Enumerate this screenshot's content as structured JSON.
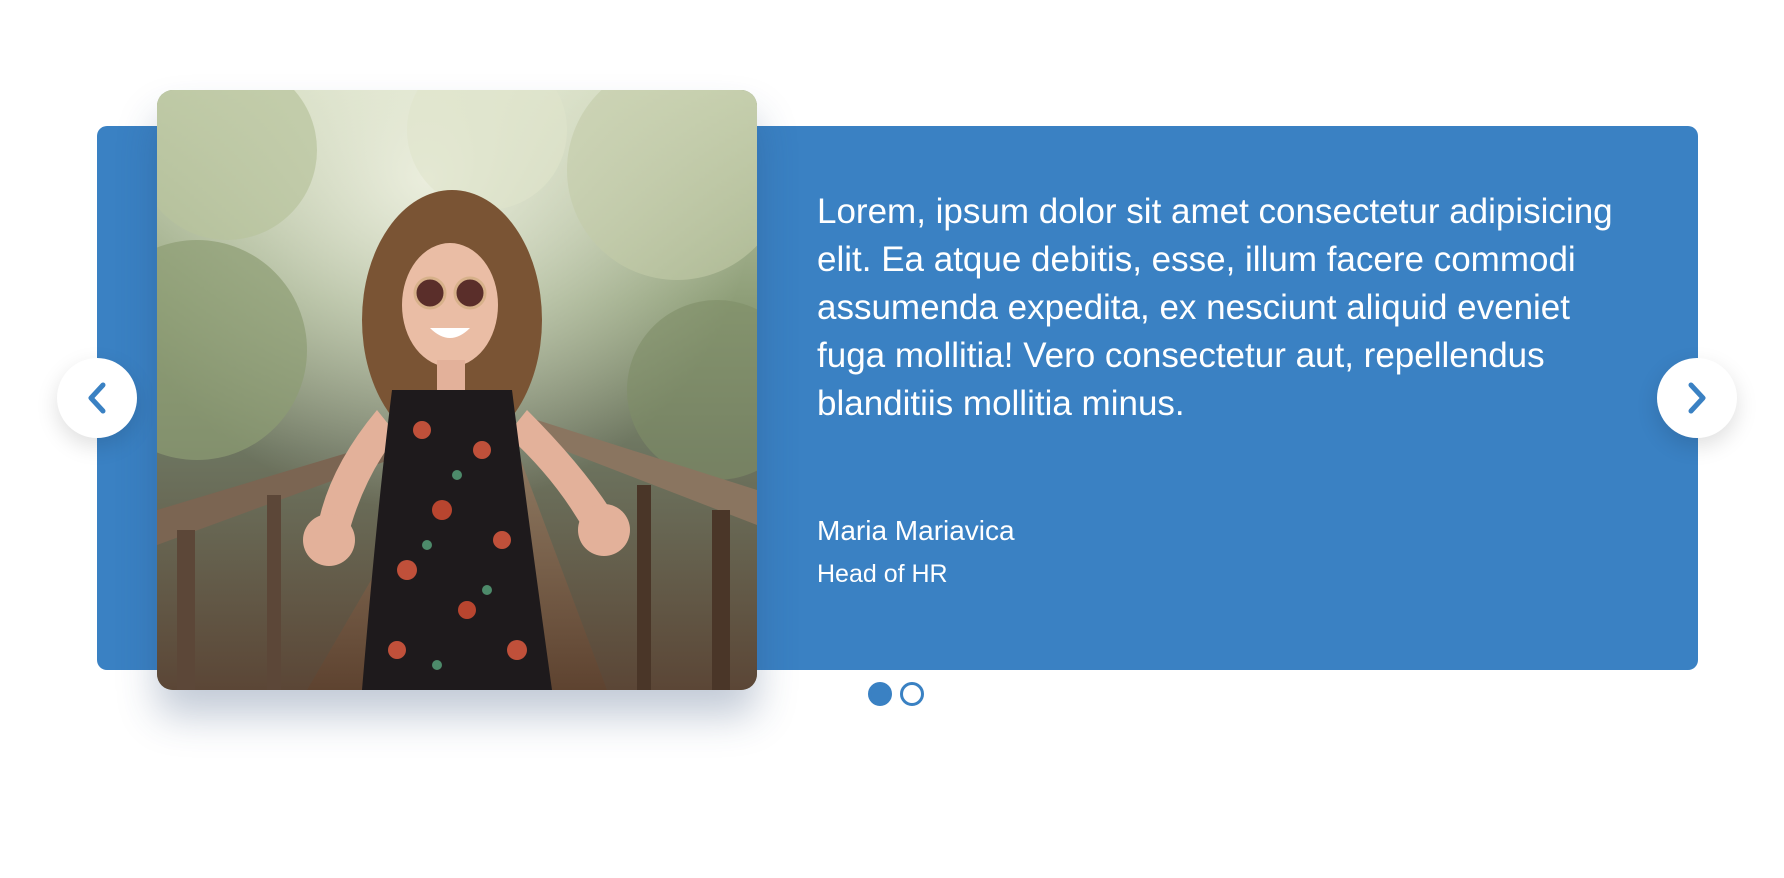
{
  "testimonial": {
    "quote": "Lorem, ipsum dolor sit amet consectetur adipisicing elit. Ea atque debitis, esse, illum facere commodi assumenda expedita, ex nesciunt aliquid eveniet fuga mollitia! Vero consectetur aut, repellendus blanditiis mollitia minus.",
    "author_name": "Maria Mariavica",
    "author_role": "Head of HR"
  },
  "navigation": {
    "prev_icon": "chevron-left-icon",
    "next_icon": "chevron-right-icon"
  },
  "pagination": {
    "total": 2,
    "active_index": 0
  },
  "colors": {
    "accent": "#3a81c3",
    "text_on_accent": "#ffffff",
    "background": "#ffffff"
  }
}
